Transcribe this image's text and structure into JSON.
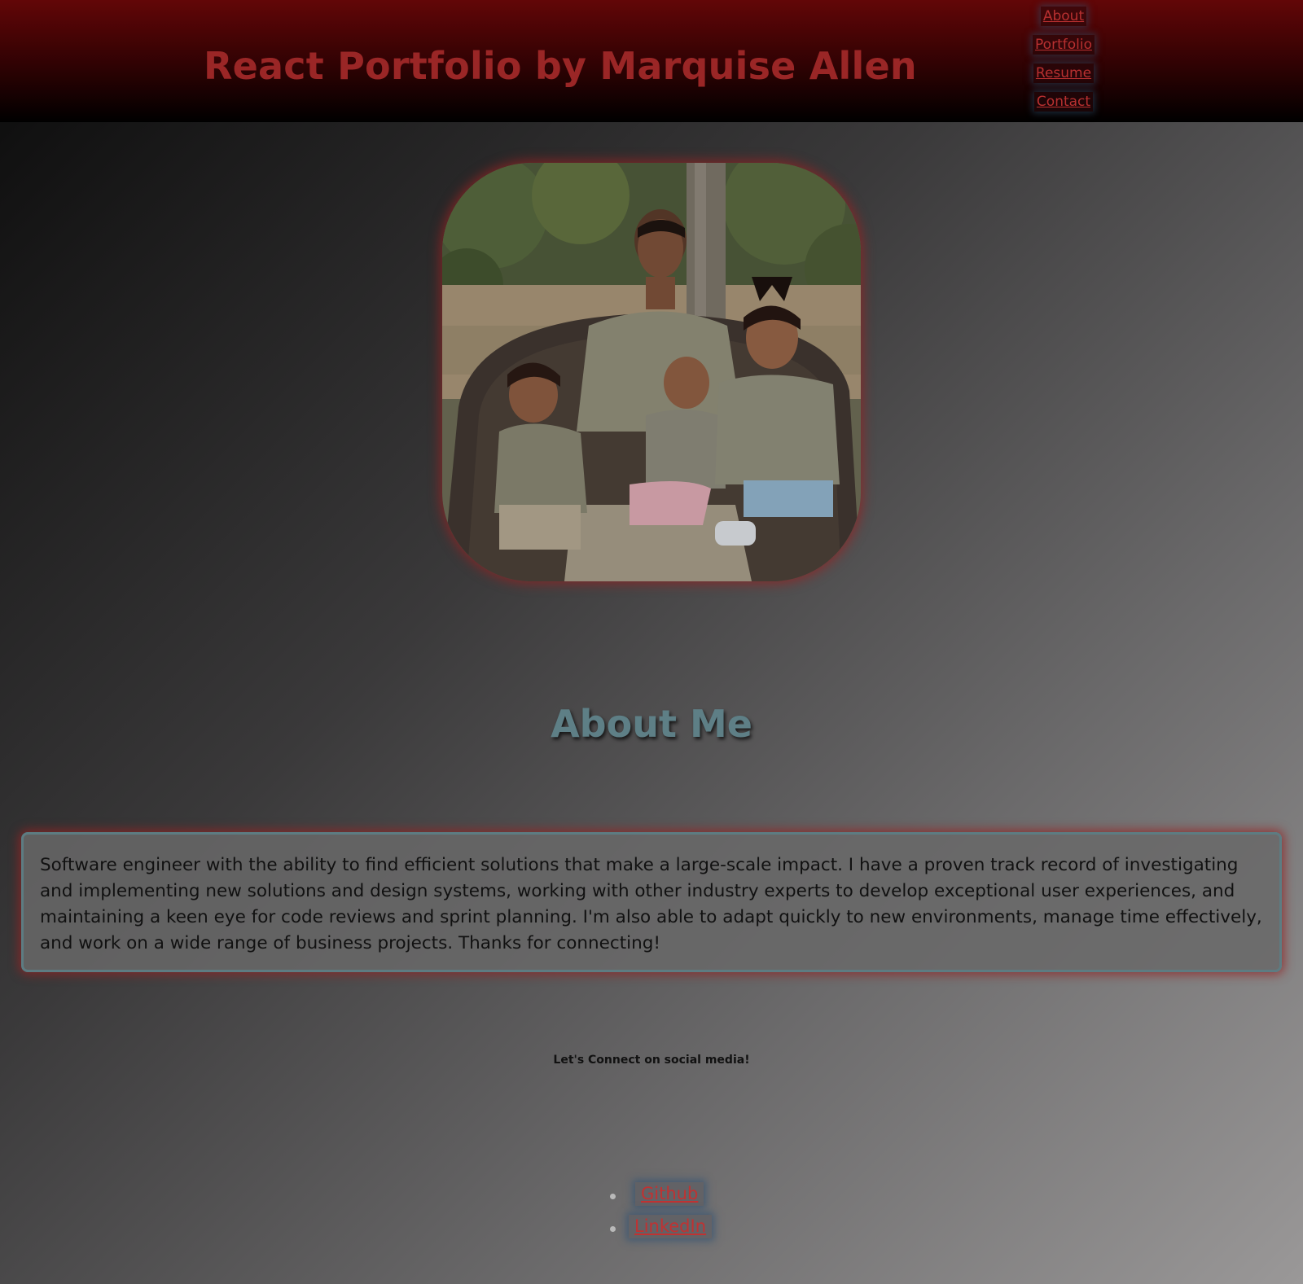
{
  "header": {
    "title": "React Portfolio by Marquise Allen",
    "nav": [
      "About",
      "Portfolio",
      "Resume",
      "Contact"
    ]
  },
  "hero": {
    "photo_description_icon": "family-photo"
  },
  "about": {
    "heading": "About Me",
    "bio": "Software engineer with the ability to find efficient solutions that make a large-scale impact. I have a proven track record of investigating and implementing new solutions and design systems, working with other industry experts to develop exceptional user experiences, and maintaining a keen eye for code reviews and sprint planning. I'm also able to adapt quickly to new environments, manage time effectively, and work on a wide range of business projects. Thanks for connecting!"
  },
  "social": {
    "label": "Let's Connect on social media!",
    "links": [
      "Github",
      "LinkedIn"
    ]
  },
  "colors": {
    "header_top": "#620607",
    "title": "#9a2626",
    "link": "#b83030",
    "heading": "#5e7f86",
    "card_border": "#5d7c82",
    "glow_red": "#962323"
  }
}
